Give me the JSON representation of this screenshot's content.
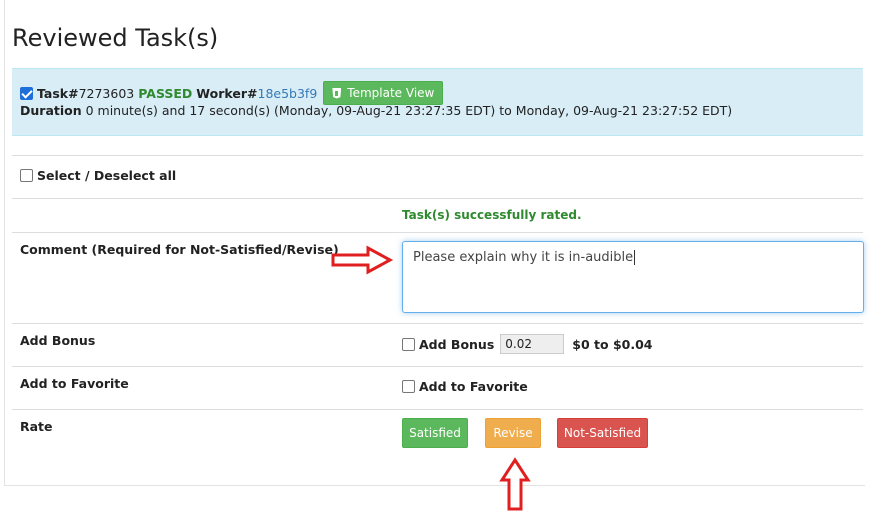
{
  "page": {
    "title": "Reviewed Task(s)"
  },
  "task": {
    "prefix": "Task#",
    "id": "7273603",
    "status": "PASSED",
    "worker_label": "Worker#",
    "worker_id": "18e5b3f9",
    "template_button": "Template View",
    "duration_label": "Duration",
    "duration_text": "0 minute(s) and 17 second(s) (Monday, 09-Aug-21 23:27:35 EDT) to Monday, 09-Aug-21 23:27:52 EDT)"
  },
  "select_all_label": "Select / Deselect all",
  "success_message": "Task(s) successfully rated.",
  "comment": {
    "label": "Comment (Required for Not-Satisfied/Revise)",
    "value": "Please explain why it is in-audible"
  },
  "bonus": {
    "row_label": "Add Bonus",
    "checkbox_label": "Add Bonus",
    "value": "0.02",
    "range": "$0 to $0.04"
  },
  "favorite": {
    "row_label": "Add to Favorite",
    "checkbox_label": "Add to Favorite"
  },
  "rate": {
    "label": "Rate",
    "satisfied": "Satisfied",
    "revise": "Revise",
    "not_satisfied": "Not-Satisfied"
  },
  "colors": {
    "panel_bg": "#d9edf7",
    "success_green": "#5cb85c",
    "warning_orange": "#f0ad4e",
    "danger_red": "#d9534f",
    "annotation_red": "#e02020"
  }
}
